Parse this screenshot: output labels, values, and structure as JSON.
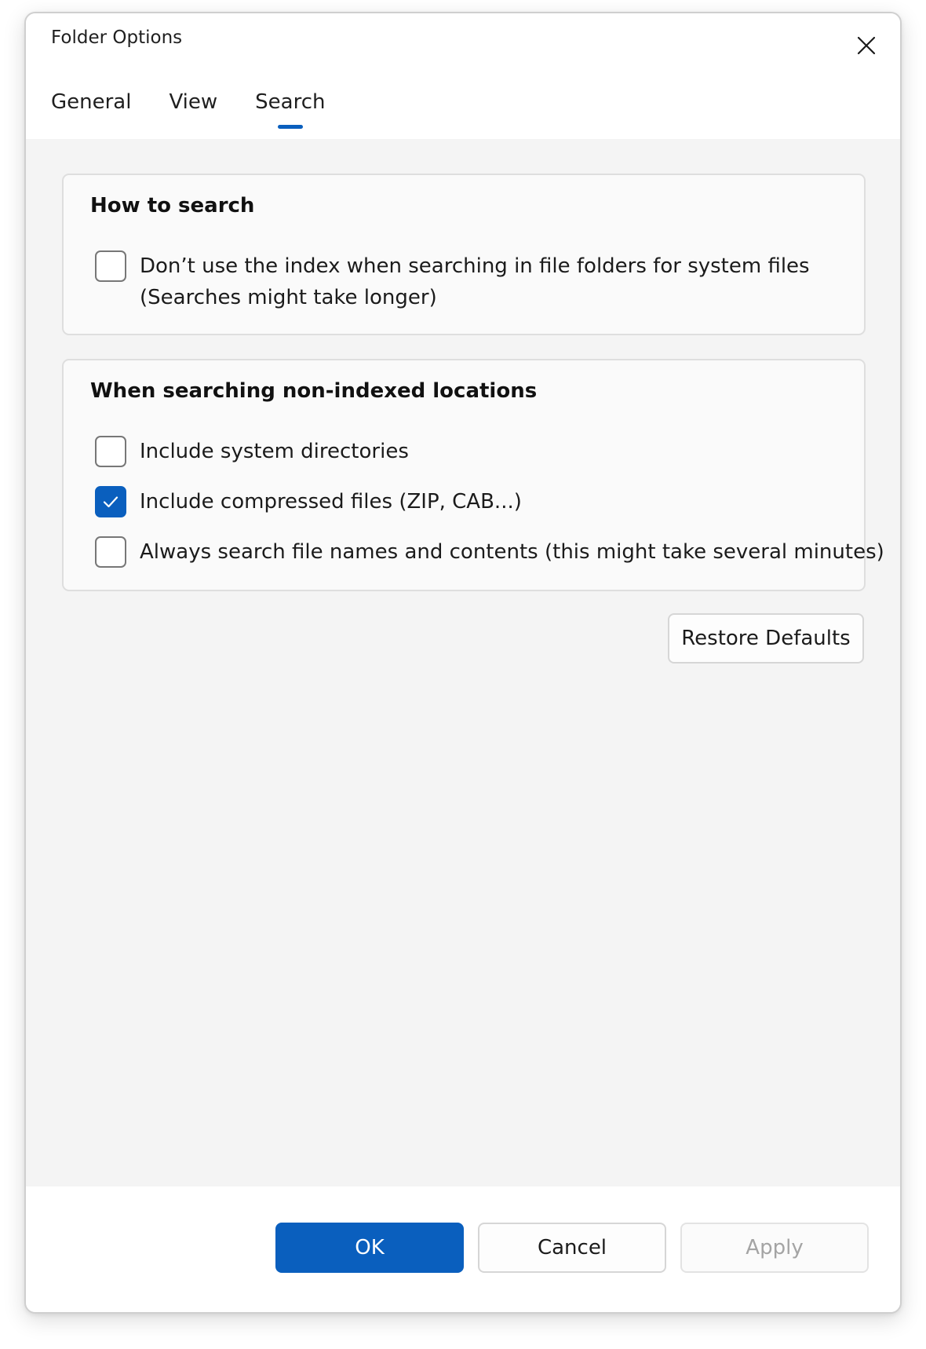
{
  "window": {
    "title": "Folder Options"
  },
  "tabs": [
    {
      "label": "General",
      "active": false
    },
    {
      "label": "View",
      "active": false
    },
    {
      "label": "Search",
      "active": true
    }
  ],
  "how_to_search": {
    "heading": "How to search",
    "options": [
      {
        "line1": "Don’t use the index when searching in file folders for system files",
        "line2": "(Searches might take longer)",
        "checked": false
      }
    ]
  },
  "non_indexed": {
    "heading": "When searching non-indexed locations",
    "options": [
      {
        "label": "Include system directories",
        "checked": false
      },
      {
        "label": "Include compressed files (ZIP, CAB...)",
        "checked": true
      },
      {
        "label": "Always search file names and contents (this might take several minutes)",
        "checked": false
      }
    ]
  },
  "buttons": {
    "restore_defaults": "Restore Defaults",
    "ok": "OK",
    "cancel": "Cancel",
    "apply": "Apply"
  },
  "colors": {
    "accent": "#0a5fbe",
    "disabled_text": "#a4a4a4"
  },
  "icons": {
    "close": "close-icon",
    "check": "checkmark-icon"
  }
}
